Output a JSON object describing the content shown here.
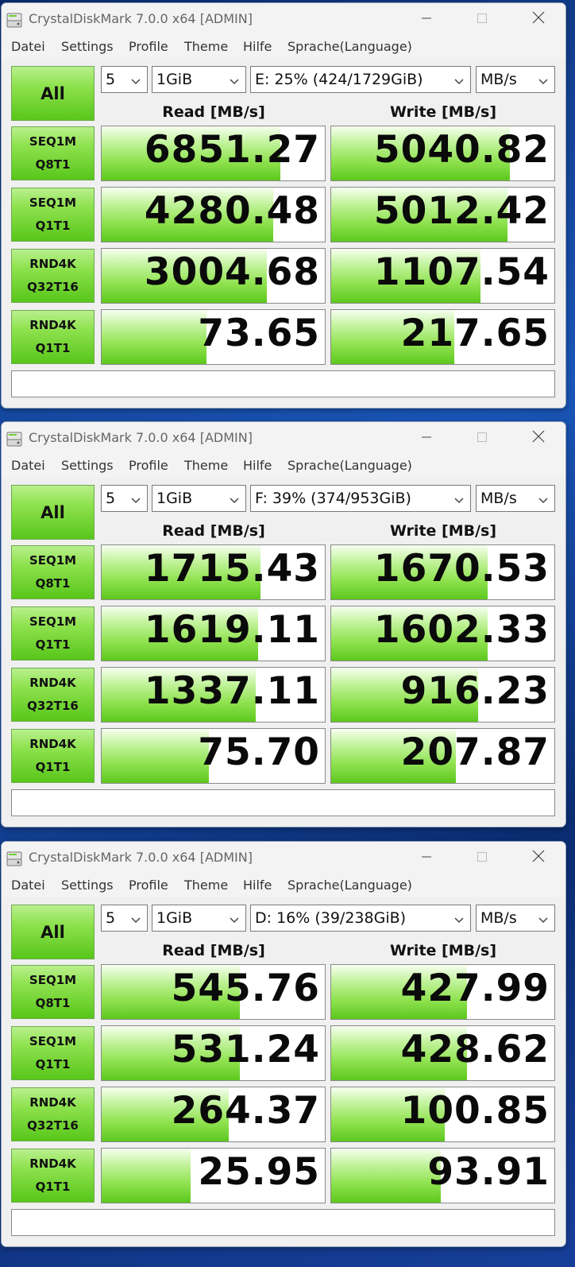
{
  "windows": [
    {
      "title": "CrystalDiskMark 7.0.0 x64 [ADMIN]",
      "menu": [
        "Datei",
        "Settings",
        "Profile",
        "Theme",
        "Hilfe",
        "Sprache(Language)"
      ],
      "all_label": "All",
      "count": "5",
      "size": "1GiB",
      "drive": "E: 25% (424/1729GiB)",
      "unit": "MB/s",
      "read_header": "Read [MB/s]",
      "write_header": "Write [MB/s]",
      "rows": [
        {
          "l1": "SEQ1M",
          "l2": "Q8T1",
          "read": "6851.27",
          "write": "5040.82",
          "read_fill": 0.8,
          "write_fill": 0.8
        },
        {
          "l1": "SEQ1M",
          "l2": "Q1T1",
          "read": "4280.48",
          "write": "5012.42",
          "read_fill": 0.77,
          "write_fill": 0.79
        },
        {
          "l1": "RND4K",
          "l2": "Q32T16",
          "read": "3004.68",
          "write": "1107.54",
          "read_fill": 0.74,
          "write_fill": 0.67
        },
        {
          "l1": "RND4K",
          "l2": "Q1T1",
          "read": "73.65",
          "write": "217.65",
          "read_fill": 0.47,
          "write_fill": 0.55
        }
      ],
      "comment": ""
    },
    {
      "title": "CrystalDiskMark 7.0.0 x64 [ADMIN]",
      "menu": [
        "Datei",
        "Settings",
        "Profile",
        "Theme",
        "Hilfe",
        "Sprache(Language)"
      ],
      "all_label": "All",
      "count": "5",
      "size": "1GiB",
      "drive": "F: 39% (374/953GiB)",
      "unit": "MB/s",
      "read_header": "Read [MB/s]",
      "write_header": "Write [MB/s]",
      "rows": [
        {
          "l1": "SEQ1M",
          "l2": "Q8T1",
          "read": "1715.43",
          "write": "1670.53",
          "read_fill": 0.71,
          "write_fill": 0.7
        },
        {
          "l1": "SEQ1M",
          "l2": "Q1T1",
          "read": "1619.11",
          "write": "1602.33",
          "read_fill": 0.7,
          "write_fill": 0.7
        },
        {
          "l1": "RND4K",
          "l2": "Q32T16",
          "read": "1337.11",
          "write": "916.23",
          "read_fill": 0.69,
          "write_fill": 0.66
        },
        {
          "l1": "RND4K",
          "l2": "Q1T1",
          "read": "75.70",
          "write": "207.87",
          "read_fill": 0.48,
          "write_fill": 0.56
        }
      ],
      "comment": ""
    },
    {
      "title": "CrystalDiskMark 7.0.0 x64 [ADMIN]",
      "menu": [
        "Datei",
        "Settings",
        "Profile",
        "Theme",
        "Hilfe",
        "Sprache(Language)"
      ],
      "all_label": "All",
      "count": "5",
      "size": "1GiB",
      "drive": "D: 16% (39/238GiB)",
      "unit": "MB/s",
      "read_header": "Read [MB/s]",
      "write_header": "Write [MB/s]",
      "rows": [
        {
          "l1": "SEQ1M",
          "l2": "Q8T1",
          "read": "545.76",
          "write": "427.99",
          "read_fill": 0.62,
          "write_fill": 0.61
        },
        {
          "l1": "SEQ1M",
          "l2": "Q1T1",
          "read": "531.24",
          "write": "428.62",
          "read_fill": 0.62,
          "write_fill": 0.61
        },
        {
          "l1": "RND4K",
          "l2": "Q32T16",
          "read": "264.37",
          "write": "100.85",
          "read_fill": 0.57,
          "write_fill": 0.51
        },
        {
          "l1": "RND4K",
          "l2": "Q1T1",
          "read": "25.95",
          "write": "93.91",
          "read_fill": 0.4,
          "write_fill": 0.49
        }
      ],
      "comment": ""
    }
  ],
  "icons": {
    "app": "disk-icon",
    "minimize": "minimize-icon",
    "maximize": "maximize-icon",
    "close": "close-icon",
    "dropdown": "chevron-down-icon"
  },
  "colors": {
    "accent_green": "#8fe24f",
    "dark_green": "#58c61a"
  }
}
